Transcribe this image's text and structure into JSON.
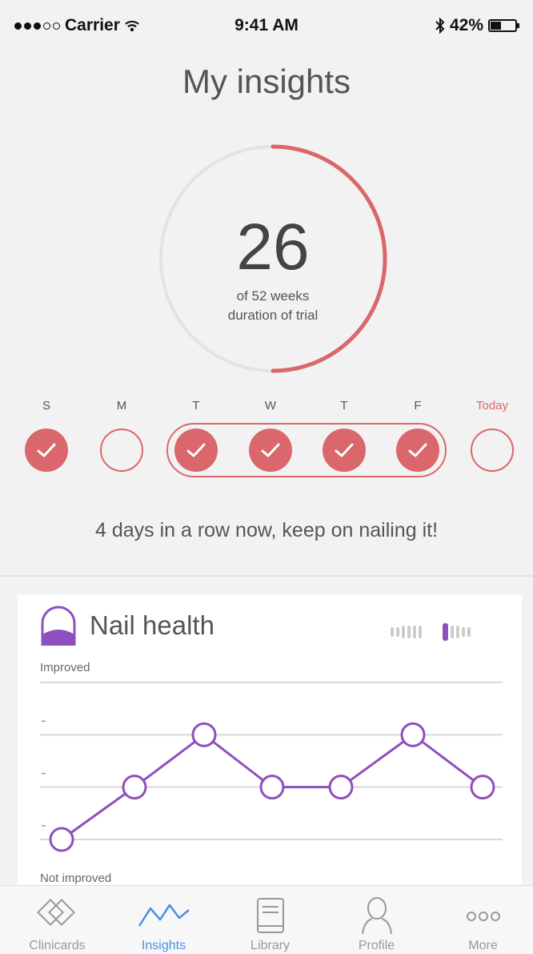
{
  "status_bar": {
    "carrier": "Carrier",
    "time": "9:41 AM",
    "battery": "42%"
  },
  "header": {
    "title": "My insights"
  },
  "progress": {
    "value": "26",
    "current_weeks": 26,
    "total_weeks": 52,
    "line1": "of 52 weeks",
    "line2": "duration of trial",
    "accent_color": "#d9676b",
    "track_color": "#e3e3e3"
  },
  "week": {
    "days": [
      {
        "label": "S",
        "checked": true
      },
      {
        "label": "M",
        "checked": false
      },
      {
        "label": "T",
        "checked": true
      },
      {
        "label": "W",
        "checked": true
      },
      {
        "label": "T",
        "checked": true
      },
      {
        "label": "F",
        "checked": true
      },
      {
        "label": "Today",
        "checked": false
      }
    ],
    "streak_message": "4 days in a row now, keep on nailing it!"
  },
  "nail_health": {
    "title": "Nail health",
    "icon": "nail-icon",
    "accent_color": "#8e4fbf",
    "axis_top_label": "Improved",
    "axis_bottom_label": "Not improved"
  },
  "chart_data": {
    "type": "line",
    "title": "Nail health",
    "ylabel_top": "Improved",
    "ylabel_bottom": "Not improved",
    "ylim": [
      0,
      3
    ],
    "grid": true,
    "series": [
      {
        "values": [
          0,
          1,
          2,
          1,
          1,
          2,
          1
        ]
      }
    ]
  },
  "tabs": [
    {
      "label": "Clinicards",
      "icon": "clinicards-icon",
      "active": false
    },
    {
      "label": "Insights",
      "icon": "insights-icon",
      "active": true
    },
    {
      "label": "Library",
      "icon": "library-icon",
      "active": false
    },
    {
      "label": "Profile",
      "icon": "profile-icon",
      "active": false
    },
    {
      "label": "More",
      "icon": "more-icon",
      "active": false
    }
  ]
}
